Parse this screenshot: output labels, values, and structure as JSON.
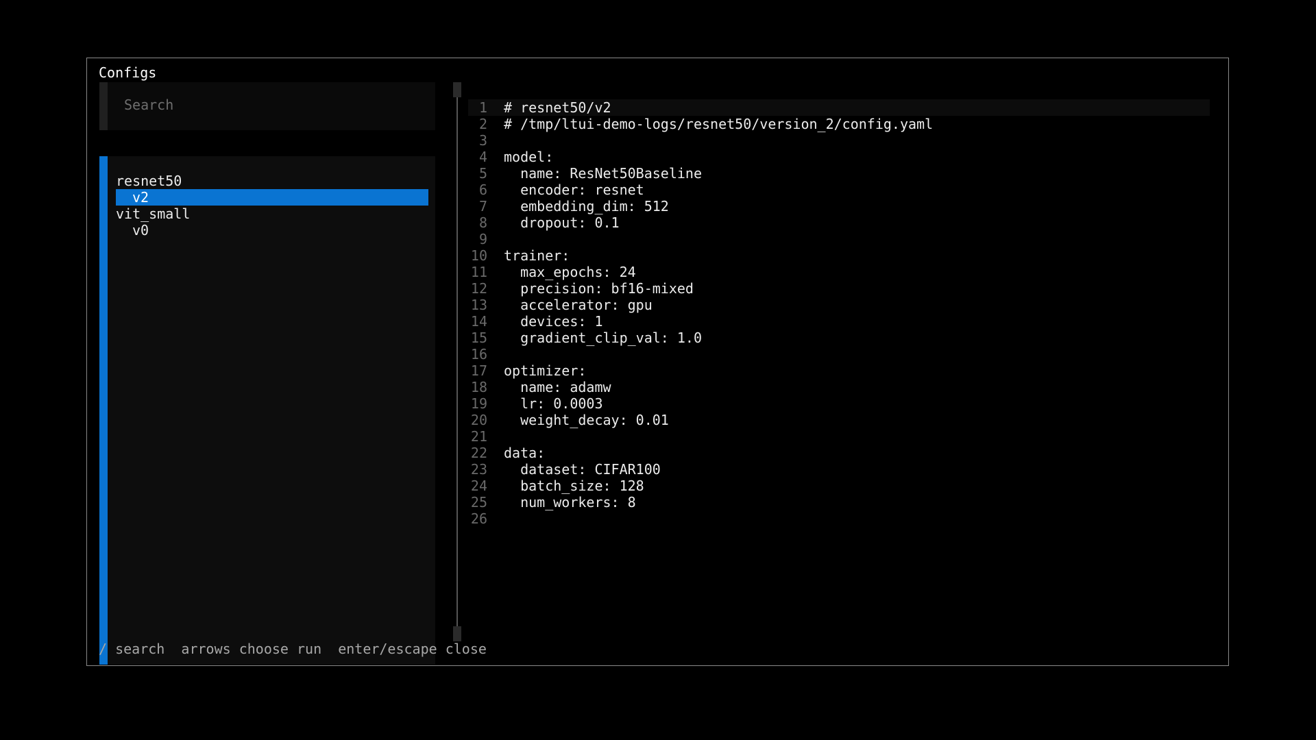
{
  "modal": {
    "title": "Configs"
  },
  "search": {
    "placeholder": "Search",
    "value": ""
  },
  "tree": {
    "items": [
      {
        "label": "resnet50",
        "level": 0,
        "selected": false
      },
      {
        "label": "v2",
        "level": 1,
        "selected": true
      },
      {
        "label": "vit_small",
        "level": 0,
        "selected": false
      },
      {
        "label": "v0",
        "level": 1,
        "selected": false
      }
    ]
  },
  "editor": {
    "current_line": 1,
    "lines": [
      "# resnet50/v2",
      "# /tmp/ltui-demo-logs/resnet50/version_2/config.yaml",
      "",
      "model:",
      "  name: ResNet50Baseline",
      "  encoder: resnet",
      "  embedding_dim: 512",
      "  dropout: 0.1",
      "",
      "trainer:",
      "  max_epochs: 24",
      "  precision: bf16-mixed",
      "  accelerator: gpu",
      "  devices: 1",
      "  gradient_clip_val: 1.0",
      "",
      "optimizer:",
      "  name: adamw",
      "  lr: 0.0003",
      "  weight_decay: 0.01",
      "",
      "data:",
      "  dataset: CIFAR100",
      "  batch_size: 128",
      "  num_workers: 8",
      ""
    ]
  },
  "footer": {
    "hints": "/ search  arrows choose run  enter/escape close"
  },
  "colors": {
    "accent": "#0a74d2",
    "background": "#000000",
    "border": "#8a8a8a",
    "line_number": "#6a6a6a"
  }
}
